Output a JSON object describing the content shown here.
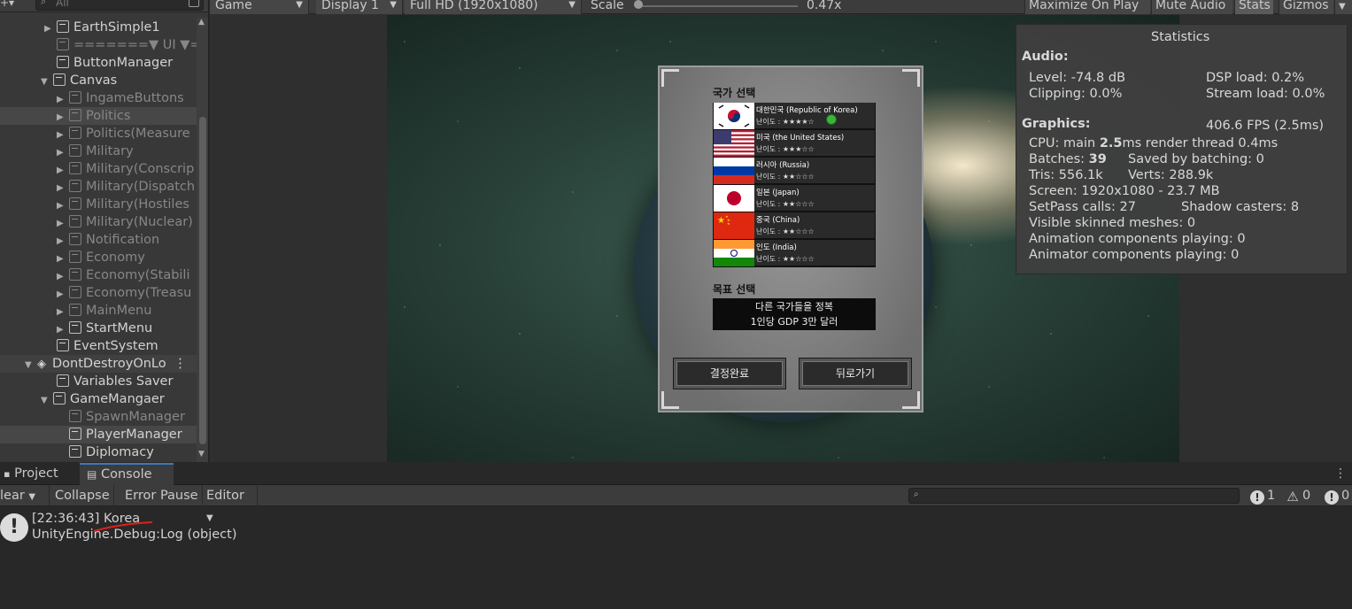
{
  "hierarchy": {
    "add_button": "+▾",
    "search_placeholder": "All",
    "items": [
      {
        "label": "EarthSimple1",
        "dim": false
      },
      {
        "label": "=======▼ UI ▼=",
        "dim": true
      },
      {
        "label": "ButtonManager",
        "dim": false
      },
      {
        "label": "Canvas",
        "dim": false
      },
      {
        "label": "IngameButtons",
        "dim": true
      },
      {
        "label": "Politics",
        "dim": true
      },
      {
        "label": "Politics(Measure",
        "dim": true
      },
      {
        "label": "Military",
        "dim": true
      },
      {
        "label": "Military(Conscrip",
        "dim": true
      },
      {
        "label": "Military(Dispatch",
        "dim": true
      },
      {
        "label": "Military(Hostiles",
        "dim": true
      },
      {
        "label": "Military(Nuclear)",
        "dim": true
      },
      {
        "label": "Notification",
        "dim": true
      },
      {
        "label": "Economy",
        "dim": true
      },
      {
        "label": "Economy(Stabili",
        "dim": true
      },
      {
        "label": "Economy(Treasu",
        "dim": true
      },
      {
        "label": "MainMenu",
        "dim": true
      },
      {
        "label": "StartMenu",
        "dim": false
      },
      {
        "label": "EventSystem",
        "dim": false
      },
      {
        "label": "DontDestroyOnLo",
        "dim": false
      },
      {
        "label": "Variables Saver",
        "dim": false
      },
      {
        "label": "GameMangaer",
        "dim": false
      },
      {
        "label": "SpawnManager",
        "dim": true
      },
      {
        "label": "PlayerManager",
        "dim": false
      },
      {
        "label": "Diplomacy",
        "dim": false
      }
    ]
  },
  "game_toolbar": {
    "view": "Game",
    "display": "Display 1",
    "resolution": "Full HD (1920x1080)",
    "scale_label": "Scale",
    "scale_value": "0.47x",
    "maximize": "Maximize On Play",
    "mute": "Mute Audio",
    "stats": "Stats",
    "gizmos": "Gizmos"
  },
  "dialog": {
    "country_heading": "국가 선택",
    "countries": [
      {
        "name": "대한민국 (Republic of Korea)",
        "difficulty": "난이도 : ★★★★☆",
        "flag": "korea"
      },
      {
        "name": "미국 (the United States)",
        "difficulty": "난이도 : ★★★☆☆",
        "flag": "usa"
      },
      {
        "name": "러시아 (Russia)",
        "difficulty": "난이도 : ★★☆☆☆",
        "flag": "russia"
      },
      {
        "name": "일본 (Japan)",
        "difficulty": "난이도 : ★★☆☆☆",
        "flag": "japan"
      },
      {
        "name": "중국 (China)",
        "difficulty": "난이도 : ★★☆☆☆",
        "flag": "china"
      },
      {
        "name": "인도 (India)",
        "difficulty": "난이도 : ★★☆☆☆",
        "flag": "india"
      }
    ],
    "goal_heading": "목표 선택",
    "goal_line1": "다른 국가들을 정복",
    "goal_line2": "1인당 GDP 3만 달러",
    "confirm": "결정완료",
    "back": "뒤로가기"
  },
  "stats": {
    "title": "Statistics",
    "audio_heading": "Audio:",
    "level": "Level: -74.8 dB",
    "dsp": "DSP load: 0.2%",
    "clipping": "Clipping: 0.0%",
    "stream": "Stream load: 0.0%",
    "graphics_heading": "Graphics:",
    "fps": "406.6 FPS (2.5ms)",
    "cpu_prefix": "CPU: main ",
    "cpu_main": "2.5",
    "cpu_suffix": "ms  render thread 0.4ms",
    "batches_prefix": "Batches: ",
    "batches": "39",
    "saved": "Saved by batching: 0",
    "tris": "Tris: 556.1k",
    "verts": "Verts: 288.9k",
    "screen": "Screen: 1920x1080 - 23.7 MB",
    "setpass": "SetPass calls: 27",
    "shadow": "Shadow casters: 8",
    "skinned": "Visible skinned meshes: 0",
    "animation": "Animation components playing: 0",
    "animator": "Animator components playing: 0"
  },
  "console": {
    "tab_project": "Project",
    "tab_console": "Console",
    "clear": "lear",
    "collapse": "Collapse",
    "error_pause": "Error Pause",
    "editor": "Editor",
    "count_info": "1",
    "count_warn": "0",
    "count_error": "0",
    "log_line1": "[22:36:43] Korea",
    "log_line2": "UnityEngine.Debug:Log (object)"
  }
}
